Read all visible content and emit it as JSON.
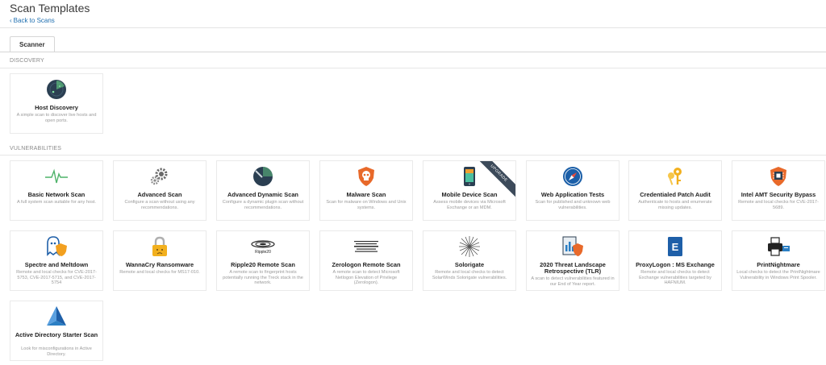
{
  "header": {
    "title": "Scan Templates",
    "back_label": "Back to Scans"
  },
  "tabs": [
    {
      "label": "Scanner"
    }
  ],
  "sections": {
    "discovery": "DISCOVERY",
    "vulnerabilities": "VULNERABILITIES"
  },
  "discovery_cards": [
    {
      "name": "Host Discovery",
      "desc": "A simple scan to discover live hosts and open ports.",
      "icon": "radar-icon"
    }
  ],
  "vuln_cards": [
    {
      "name": "Basic Network Scan",
      "desc": "A full system scan suitable for any host.",
      "icon": "pulse-icon"
    },
    {
      "name": "Advanced Scan",
      "desc": "Configure a scan without using any recommendations.",
      "icon": "gears-icon"
    },
    {
      "name": "Advanced Dynamic Scan",
      "desc": "Configure a dynamic plugin scan without recommendations.",
      "icon": "dynamic-radar-icon"
    },
    {
      "name": "Malware Scan",
      "desc": "Scan for malware on Windows and Unix systems.",
      "icon": "skull-shield-icon"
    },
    {
      "name": "Mobile Device Scan",
      "desc": "Assess mobile devices via Microsoft Exchange or an MDM.",
      "icon": "smartphone-icon",
      "badge": "UPGRADE"
    },
    {
      "name": "Web Application Tests",
      "desc": "Scan for published and unknown web vulnerabilities.",
      "icon": "compass-icon"
    },
    {
      "name": "Credentialed Patch Audit",
      "desc": "Authenticate to hosts and enumerate missing updates.",
      "icon": "keys-icon"
    },
    {
      "name": "Intel AMT Security Bypass",
      "desc": "Remote and local checks for CVE-2017-5689.",
      "icon": "chip-shield-icon"
    },
    {
      "name": "Spectre and Meltdown",
      "desc": "Remote and local checks for CVE-2017-5753, CVE-2017-5715, and CVE-2017-5754",
      "icon": "ghost-shield-icon"
    },
    {
      "name": "WannaCry Ransomware",
      "desc": "Remote and local checks for MS17-010.",
      "icon": "padlock-icon"
    },
    {
      "name": "Ripple20 Remote Scan",
      "desc": "A remote scan to fingerprint hosts potentially running the Treck stack in the network.",
      "icon": "ripple20-logo-icon",
      "icon_text": "Ripple20"
    },
    {
      "name": "Zerologon Remote Scan",
      "desc": "A remote scan to detect Microsoft Netlogon Elevation of Privilege (Zerologon).",
      "icon": "zerologon-logo-icon"
    },
    {
      "name": "Solorigate",
      "desc": "Remote and local checks to detect SolarWinds Solorigate vulnerabilities.",
      "icon": "starburst-icon"
    },
    {
      "name": "2020 Threat Landscape Retrospective (TLR)",
      "desc": "A scan to detect vulnerabilities featured in our End of Year report.",
      "icon": "report-shield-icon"
    },
    {
      "name": "ProxyLogon : MS Exchange",
      "desc": "Remote and local checks to detect Exchange vulnerabilities targeted by HAFNIUM.",
      "icon": "exchange-logo-icon",
      "icon_text": "E"
    },
    {
      "name": "PrintNightmare",
      "desc": "Local checks to detect the PrintNightmare Vulnerability in Windows Print Spooler.",
      "icon": "printer-icon"
    },
    {
      "name": "Active Directory Starter Scan",
      "desc": "Look for misconfigurations in Active Directory.",
      "icon": "ad-triangle-icon"
    }
  ],
  "colors": {
    "link": "#1f6fb0",
    "ribbon": "#3c4a5a",
    "shield_orange": "#e8692a",
    "dark_navy": "#2b3f52"
  }
}
